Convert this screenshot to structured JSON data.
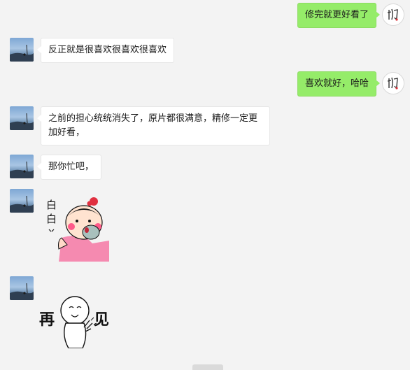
{
  "colors": {
    "background": "#f3f3f3",
    "outgoing_bubble": "#95ec69",
    "incoming_bubble": "#ffffff"
  },
  "messages": [
    {
      "direction": "outgoing",
      "type": "text",
      "text": "修完就更好看了"
    },
    {
      "direction": "incoming",
      "type": "text",
      "text": "反正就是很喜欢很喜欢很喜欢"
    },
    {
      "direction": "outgoing",
      "type": "text",
      "text": "喜欢就好，哈哈"
    },
    {
      "direction": "incoming",
      "type": "text",
      "text": "之前的担心统统消失了，原片都很满意，精修一定更加好看，"
    },
    {
      "direction": "incoming",
      "type": "text",
      "text": "那你忙吧，"
    },
    {
      "direction": "incoming",
      "type": "sticker",
      "sticker_text": "白白",
      "icon": "blushing-cartoon-sticker"
    },
    {
      "direction": "incoming",
      "type": "sticker",
      "sticker_text": "再见",
      "icon": "waving-cartoon-sticker"
    }
  ],
  "avatars": {
    "contact": "scenic-photo-avatar",
    "self": "calligraphy-avatar"
  }
}
